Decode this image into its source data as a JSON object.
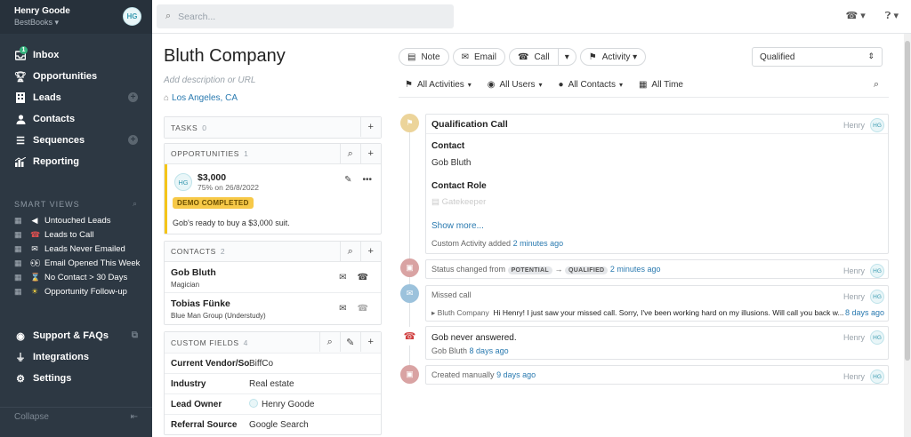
{
  "user": {
    "name": "Henry Goode",
    "org": "BestBooks",
    "initials": "HG"
  },
  "nav": [
    {
      "label": "Inbox",
      "icon": "inbox-icon",
      "badge": "1"
    },
    {
      "label": "Opportunities",
      "icon": "trophy-icon"
    },
    {
      "label": "Leads",
      "icon": "building-icon"
    },
    {
      "label": "Contacts",
      "icon": "person-icon"
    },
    {
      "label": "Sequences",
      "icon": "list-icon"
    },
    {
      "label": "Reporting",
      "icon": "chart-icon"
    }
  ],
  "smart_views": {
    "title": "SMART VIEWS",
    "items": [
      {
        "label": "Untouched Leads",
        "emoji": "📣"
      },
      {
        "label": "Leads to Call",
        "emoji": "📞"
      },
      {
        "label": "Leads Never Emailed",
        "emoji": "📨"
      },
      {
        "label": "Email Opened This Week",
        "emoji": "👀"
      },
      {
        "label": "No Contact > 30 Days",
        "emoji": "⏳"
      },
      {
        "label": "Opportunity Follow-up",
        "emoji": "☀"
      }
    ]
  },
  "nav_bottom": [
    {
      "label": "Support & FAQs",
      "icon": "lifebuoy-icon"
    },
    {
      "label": "Integrations",
      "icon": "plug-icon"
    },
    {
      "label": "Settings",
      "icon": "gear-icon"
    }
  ],
  "collapse_label": "Collapse",
  "search": {
    "placeholder": "Search..."
  },
  "company": {
    "name": "Bluth Company",
    "description_placeholder": "Add description or URL",
    "location": "Los Angeles, CA"
  },
  "tasks": {
    "title": "TASKS",
    "count": "0"
  },
  "opportunities": {
    "title": "OPPORTUNITIES",
    "count": "1",
    "item": {
      "initials": "HG",
      "amount": "$3,000",
      "detail": "75% on 26/8/2022",
      "status": "DEMO COMPLETED",
      "note": "Gob's ready to buy a $3,000 suit."
    }
  },
  "contacts": {
    "title": "CONTACTS",
    "count": "2",
    "items": [
      {
        "name": "Gob Bluth",
        "title": "Magician"
      },
      {
        "name": "Tobias Fünke",
        "title": "Blue Man Group (Understudy)"
      }
    ]
  },
  "custom_fields": {
    "title": "CUSTOM FIELDS",
    "count": "4",
    "rows": [
      {
        "key": "Current Vendor/Sof...",
        "value": "BiffCo"
      },
      {
        "key": "Industry",
        "value": "Real estate"
      },
      {
        "key": "Lead Owner",
        "value": "Henry Goode"
      },
      {
        "key": "Referral Source",
        "value": "Google Search"
      }
    ]
  },
  "actions": {
    "note": "Note",
    "email": "Email",
    "call": "Call",
    "activity": "Activity"
  },
  "status": {
    "value": "Qualified"
  },
  "filters": {
    "activities": "All Activities",
    "users": "All Users",
    "contacts": "All Contacts",
    "time": "All Time"
  },
  "activities": {
    "qualification": {
      "title": "Qualification Call",
      "user": "Henry",
      "initials": "HG",
      "contact_label": "Contact",
      "contact_value": "Gob Bluth",
      "role_label": "Contact Role",
      "role_value": "Gatekeeper",
      "show_more": "Show more...",
      "footer_prefix": "Custom Activity added",
      "footer_time": "2 minutes ago"
    },
    "status_change": {
      "prefix": "Status changed from",
      "from": "POTENTIAL",
      "arrow": "→",
      "to": "QUALIFIED",
      "time": "2 minutes ago",
      "user": "Henry",
      "initials": "HG"
    },
    "missed_call": {
      "title": "Missed call",
      "user": "Henry",
      "initials": "HG",
      "company": "Bluth Company",
      "message": "Hi Henry! I just saw your missed call. Sorry, I've been working hard on my illusions. Will call you back w...",
      "time": "8 days ago"
    },
    "note": {
      "text": "Gob never answered.",
      "author": "Gob Bluth",
      "time": "8 days ago",
      "user": "Henry",
      "initials": "HG"
    },
    "created": {
      "prefix": "Created manually",
      "time": "9 days ago",
      "user": "Henry",
      "initials": "HG"
    }
  },
  "colors": {
    "sidebar": "#2d3843",
    "accent": "#2a7ab0",
    "demo_badge": "#f7c948"
  }
}
